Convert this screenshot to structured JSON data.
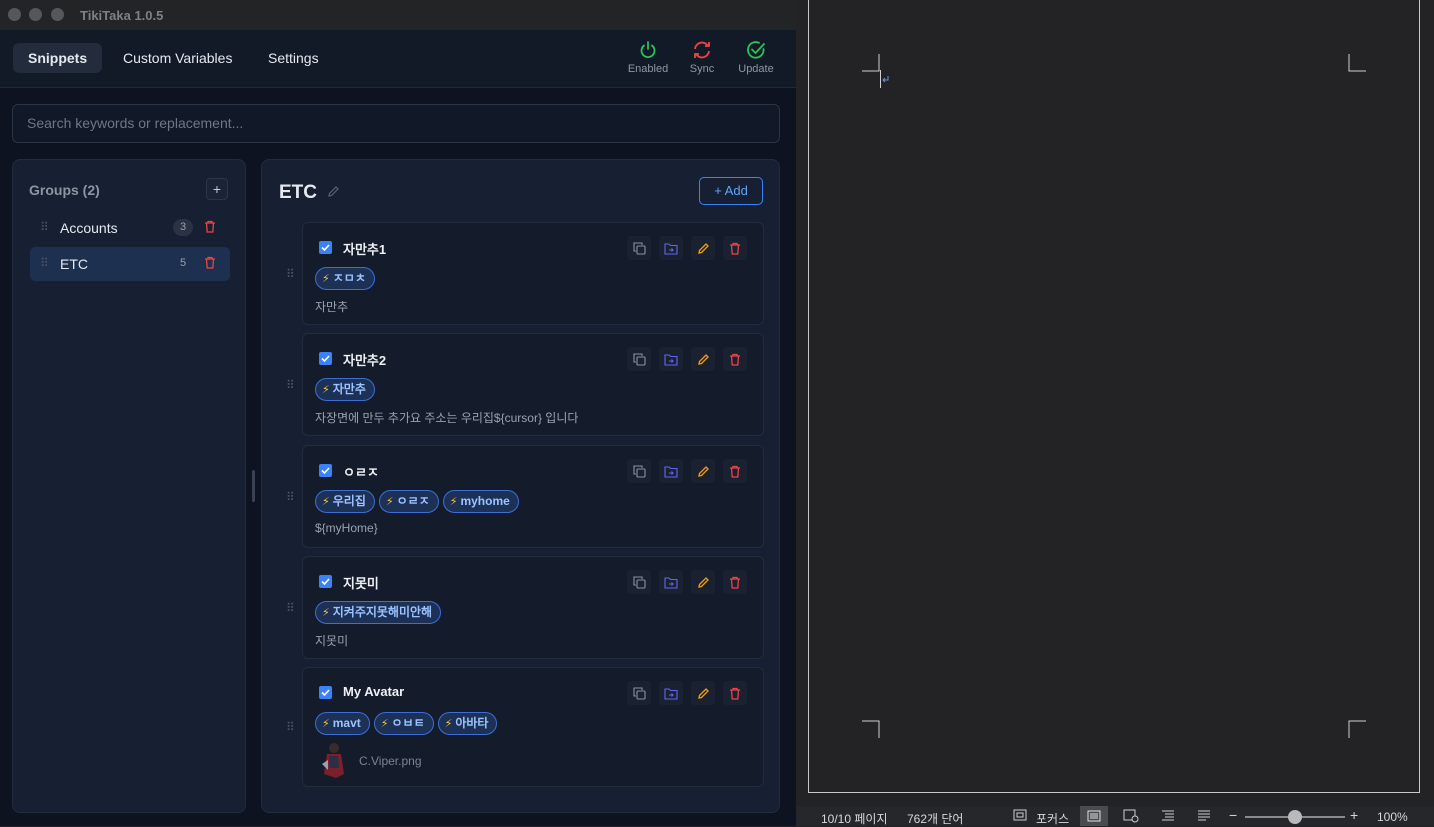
{
  "window": {
    "title": "TikiTaka 1.0.5"
  },
  "tabs": [
    {
      "label": "Snippets",
      "active": true
    },
    {
      "label": "Custom Variables",
      "active": false
    },
    {
      "label": "Settings",
      "active": false
    }
  ],
  "toolbar": {
    "enabled_label": "Enabled",
    "sync_label": "Sync",
    "update_label": "Update"
  },
  "search": {
    "placeholder": "Search keywords or replacement..."
  },
  "groups": {
    "title": "Groups (2)",
    "add_label": "+",
    "items": [
      {
        "label": "Accounts",
        "count": "3",
        "active": false
      },
      {
        "label": "ETC",
        "count": "5",
        "active": true
      }
    ]
  },
  "group_view": {
    "title": "ETC",
    "add_button": "+ Add",
    "snippets": [
      {
        "title": "자만추1",
        "enabled": true,
        "keywords": [
          "ㅈㅁㅊ"
        ],
        "replacement": "자만추"
      },
      {
        "title": "자만추2",
        "enabled": true,
        "keywords": [
          "자만추"
        ],
        "replacement": "자장면에 만두 추가요 주소는 우리집${cursor} 입니다"
      },
      {
        "title": "ㅇㄹㅈ",
        "enabled": true,
        "keywords": [
          "우리집",
          "ㅇㄹㅈ",
          "myhome"
        ],
        "replacement": "${myHome}"
      },
      {
        "title": "지못미",
        "enabled": true,
        "keywords": [
          "지켜주지못해미안해"
        ],
        "replacement": "지못미"
      },
      {
        "title": "My Avatar",
        "enabled": true,
        "keywords": [
          "mavt",
          "ㅇㅂㅌ",
          "아바타"
        ],
        "replacement_image": "C.Viper.png"
      }
    ]
  },
  "word_doc": {
    "status": {
      "page": "10/10 페이지",
      "words": "762개 단어",
      "focus": "포커스",
      "zoom": "100%",
      "zoom_level": 0.5
    }
  },
  "colors": {
    "accent": "#3b82f6",
    "enabled_green": "#22c55e",
    "sync_red": "#ef4444",
    "delete_red": "#ef4444",
    "edit_orange": "#f59e0b",
    "move_blue": "#6366f1"
  }
}
